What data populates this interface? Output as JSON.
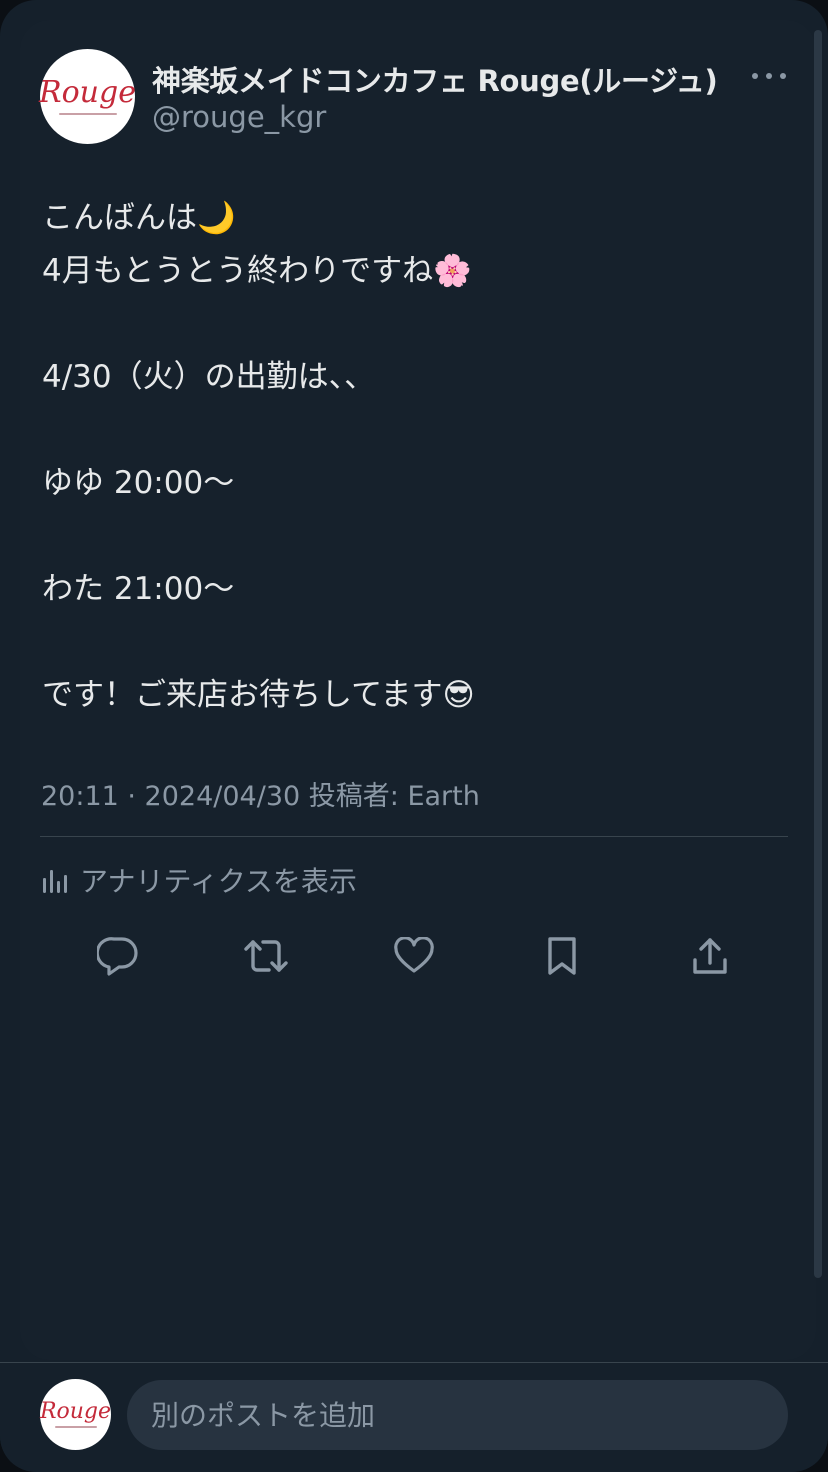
{
  "account": {
    "avatar_logo_text": "Rouge",
    "display_name": "神楽坂メイドコンカフェ Rouge(ルージュ)",
    "handle": "@rouge_kgr"
  },
  "tweet": {
    "text": "こんばんは🌙\n4月もとうとう終わりですね🌸\n\n4/30（火）の出勤は、、\n\nゆゆ 20:00～\n\nわた 21:00～\n\nです！ご来店お待ちしてます😎",
    "meta": "20:11 · 2024/04/30 投稿者: Earth"
  },
  "analytics": {
    "label": "アナリティクスを表示",
    "icon": "bar-chart-icon"
  },
  "actions": [
    {
      "name": "reply",
      "icon": "reply-icon"
    },
    {
      "name": "retweet",
      "icon": "retweet-icon"
    },
    {
      "name": "like",
      "icon": "heart-icon"
    },
    {
      "name": "bookmark",
      "icon": "bookmark-icon"
    },
    {
      "name": "share",
      "icon": "share-icon"
    }
  ],
  "composer": {
    "placeholder": "別のポストを追加"
  },
  "colors": {
    "background": "#15202b",
    "text_primary": "#e7e9ea",
    "text_secondary": "#8b98a5",
    "divider": "#38444d",
    "brand_red": "#c42a3a"
  }
}
